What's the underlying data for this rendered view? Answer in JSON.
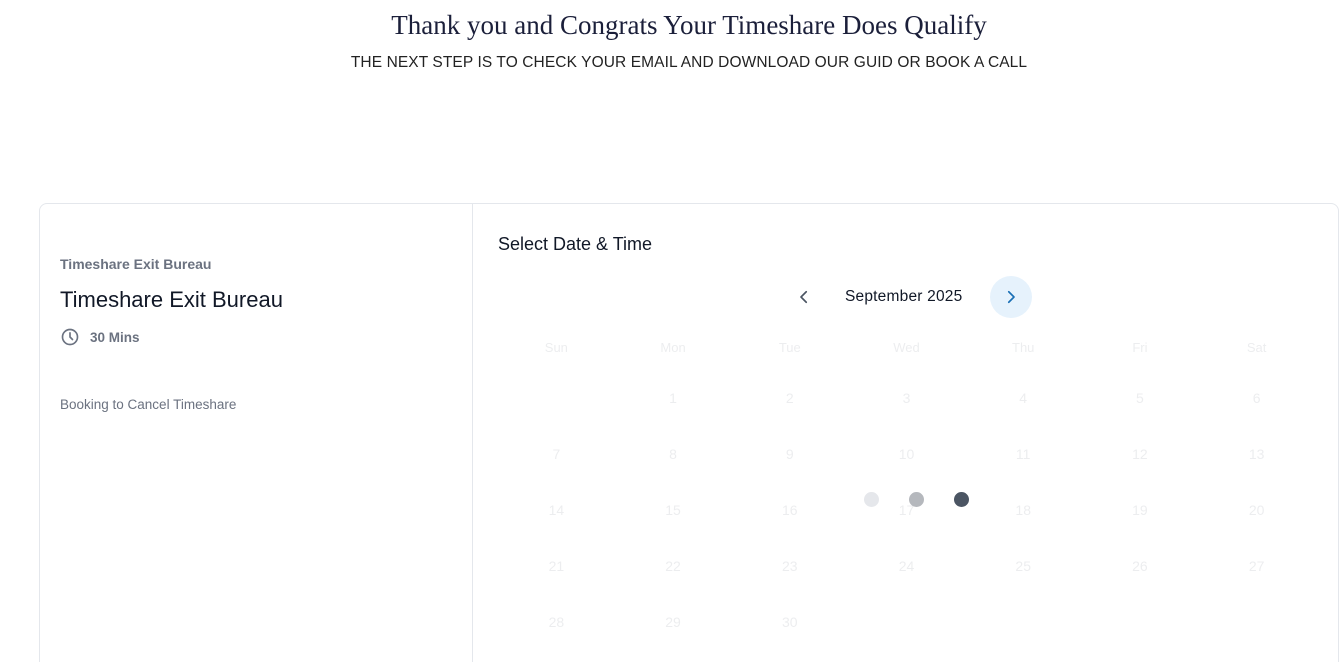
{
  "hero": {
    "title": "Thank you and Congrats Your Timeshare Does Qualify",
    "subtitle": "THE NEXT STEP IS TO CHECK YOUR EMAIL AND DOWNLOAD OUR GUID OR BOOK A CALL"
  },
  "booking": {
    "company": "Timeshare Exit Bureau",
    "event_title": "Timeshare Exit Bureau",
    "duration": "30 Mins",
    "description": "Booking to Cancel Timeshare",
    "duration_icon": "clock-icon"
  },
  "scheduler": {
    "section_title": "Select Date & Time",
    "month": "September 2025",
    "prev_icon": "chevron-left-icon",
    "next_icon": "chevron-right-icon",
    "weekdays": [
      "Sun",
      "Mon",
      "Tue",
      "Wed",
      "Thu",
      "Fri",
      "Sat"
    ],
    "days": [
      "",
      "1",
      "2",
      "3",
      "4",
      "5",
      "6",
      "7",
      "8",
      "9",
      "10",
      "11",
      "12",
      "13",
      "14",
      "15",
      "16",
      "17",
      "18",
      "19",
      "20",
      "21",
      "22",
      "23",
      "24",
      "25",
      "26",
      "27",
      "28",
      "29",
      "30"
    ],
    "loading": true
  },
  "colors": {
    "accent": "#1a6fb5",
    "next_button_bg": "#e6f2fc",
    "border": "#e4e7ec",
    "muted_text": "#6b7280"
  }
}
